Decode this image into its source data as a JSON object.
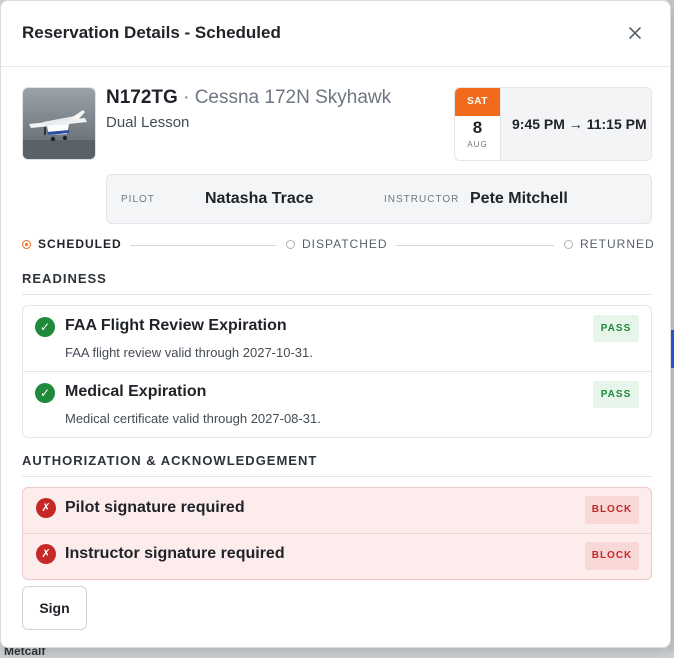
{
  "modal": {
    "title": "Reservation Details - Scheduled",
    "close_icon": "close-icon"
  },
  "aircraft": {
    "tail_number": "N172TG",
    "separator": " · ",
    "model": "Cessna 172N Skyhawk",
    "lesson_type": "Dual Lesson",
    "photo_icon": "aircraft-photo"
  },
  "schedule": {
    "day_of_week": "SAT",
    "day": "8",
    "month": "AUG",
    "time_range": "9:45 PM → 11:15 PM"
  },
  "crew": {
    "pilot_label": "PILOT",
    "pilot_name": "Natasha Trace",
    "instructor_label": "INSTRUCTOR",
    "instructor_name": "Pete Mitchell"
  },
  "status_steps": [
    {
      "label": "SCHEDULED",
      "active": true
    },
    {
      "label": "DISPATCHED",
      "active": false
    },
    {
      "label": "RETURNED",
      "active": false
    }
  ],
  "readiness": {
    "title": "READINESS",
    "items": [
      {
        "title": "FAA Flight Review Expiration",
        "description": "FAA flight review valid through 2027-10-31.",
        "badge": "PASS",
        "icon": "check-icon"
      },
      {
        "title": "Medical Expiration",
        "description": "Medical certificate valid through 2027-08-31.",
        "badge": "PASS",
        "icon": "check-icon"
      }
    ]
  },
  "authorization": {
    "title": "AUTHORIZATION & ACKNOWLEDGEMENT",
    "items": [
      {
        "title": "Pilot signature required",
        "badge": "BLOCK",
        "icon": "x-icon"
      },
      {
        "title": "Instructor signature required",
        "badge": "BLOCK",
        "icon": "x-icon"
      }
    ]
  },
  "actions": {
    "sign_label": "Sign"
  },
  "colors": {
    "accent": "#f26b1d",
    "pass": "#1f8a3b",
    "block": "#c62828"
  },
  "background": {
    "partial_text": "Metcalf"
  }
}
